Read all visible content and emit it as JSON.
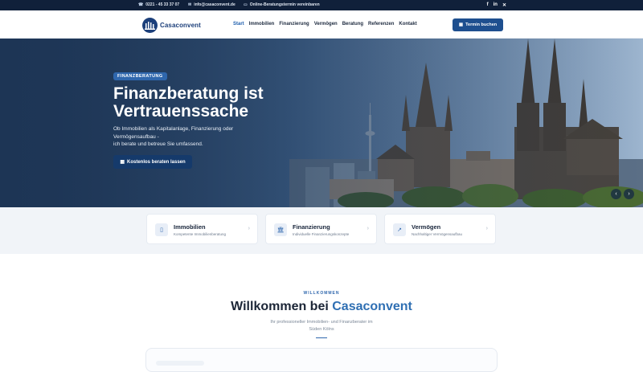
{
  "topbar": {
    "phone": "0221 - 45 33 37 07",
    "email": "info@casaconvent.de",
    "online": "Online-Beratungstermin vereinbaren",
    "social_facebook": "f",
    "social_linkedin": "in",
    "social_x": "✕"
  },
  "nav": {
    "logo_text": "Casaconvent",
    "items": [
      "Start",
      "Immobilien",
      "Finanzierung",
      "Vermögen",
      "Beratung",
      "Referenzen",
      "Kontakt"
    ],
    "cta": "Termin buchen"
  },
  "hero": {
    "badge": "FINANZBERATUNG",
    "title_line1": "Finanzberatung ist",
    "title_line2": "Vertrauenssache",
    "text_line1": "Ob Immobilien als Kapitalanlage, Finanzierung oder",
    "text_line2": "Vermögensaufbau -",
    "text_line3": "ich berate und betreue Sie umfassend.",
    "button": "Kostenlos beraten lassen",
    "prev": "‹",
    "next": "›"
  },
  "cards": [
    {
      "title": "Immobilien",
      "subtitle": "Kompetente Immobilienberatung",
      "icon": "▯"
    },
    {
      "title": "Finanzierung",
      "subtitle": "Individuelle Finanzierungskonzepte",
      "icon": "🏛"
    },
    {
      "title": "Vermögen",
      "subtitle": "Nachhaltiger Vermögensaufbau",
      "icon": "↗"
    }
  ],
  "welcome": {
    "kicker": "WILLKOMMEN",
    "title_prefix": "Willkommen bei",
    "title_accent": "Casaconvent",
    "sub_line1": "Ihr professioneller Immobilien- und Finanzberater im",
    "sub_line2": "Süden Kölns"
  },
  "colors": {
    "topbar": "#10203a",
    "primary": "#1e4f8f",
    "accent": "#2f6fb3",
    "hero_dark": "#1d3555"
  }
}
